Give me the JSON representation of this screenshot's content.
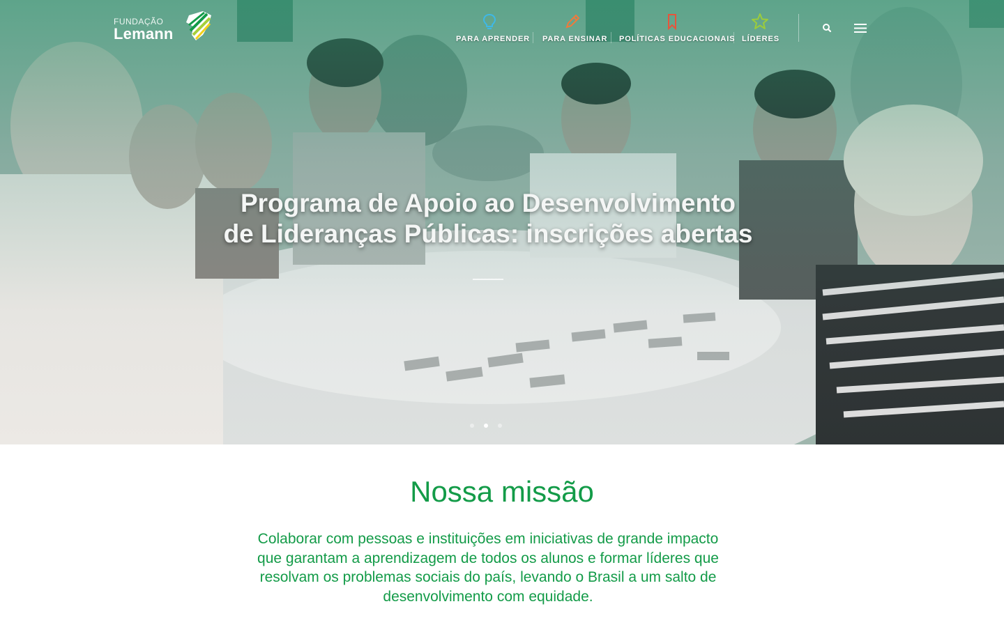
{
  "brand": {
    "small": "FUNDAÇÃO",
    "name": "Lemann",
    "colors": {
      "green": "#139b48",
      "lime": "#a6d03b",
      "yellow": "#f2d21a"
    }
  },
  "nav": {
    "items": [
      {
        "label": "PARA APRENDER",
        "icon": "lightbulb-icon",
        "color": "#3fb8e6"
      },
      {
        "label": "PARA ENSINAR",
        "icon": "pencil-icon",
        "color": "#f07a3b"
      },
      {
        "label": "POLÍTICAS EDUCACIONAIS",
        "icon": "bookmark-icon",
        "color": "#e6553b"
      },
      {
        "label": "LÍDERES",
        "icon": "star-icon",
        "color": "#9ccc3b"
      }
    ],
    "search_icon": "search-icon",
    "menu_icon": "hamburger-menu-icon"
  },
  "hero": {
    "title_line1": "Programa de Apoio ao Desenvolvimento",
    "title_line2": "de Lideranças Públicas: inscrições abertas",
    "slide_count": 3,
    "active_slide": 2
  },
  "mission": {
    "title": "Nossa missão",
    "lines": [
      "Colaborar com pessoas e instituições em iniciativas de grande impacto",
      "que garantam a aprendizagem de todos os alunos e formar líderes que",
      "resolvam os problemas sociais do país, levando o Brasil a um salto de",
      "desenvolvimento com equidade."
    ]
  }
}
